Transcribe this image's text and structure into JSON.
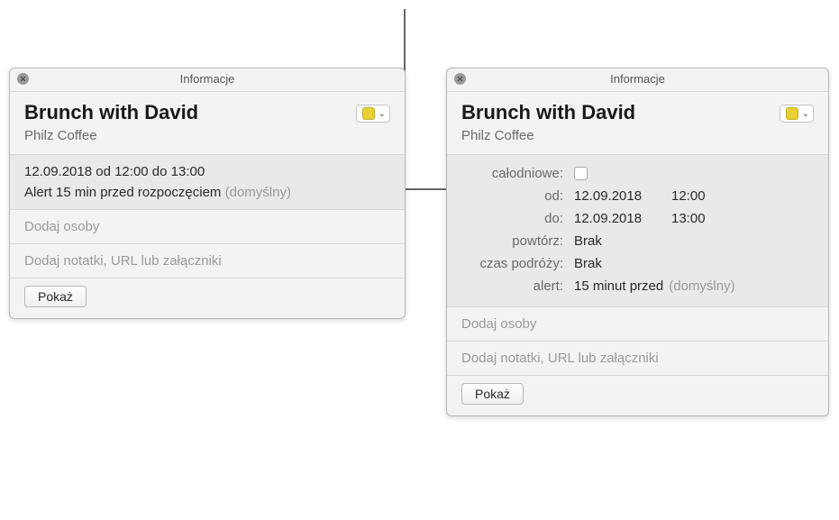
{
  "window_title": "Informacje",
  "event": {
    "title": "Brunch with David",
    "location": "Philz Coffee"
  },
  "left": {
    "time_line": "12.09.2018  od 12:00 do 13:00",
    "alert_prefix": "Alert 15 min przed rozpoczęciem",
    "alert_default": "(domyślny)"
  },
  "right": {
    "labels": {
      "allday": "całodniowe:",
      "from": "od:",
      "to": "do:",
      "repeat": "powtórz:",
      "travel": "czas podróży:",
      "alert": "alert:"
    },
    "from_date": "12.09.2018",
    "from_time": "12:00",
    "to_date": "12.09.2018",
    "to_time": "13:00",
    "repeat_value": "Brak",
    "travel_value": "Brak",
    "alert_value": "15 minut przed",
    "alert_default": "(domyślny)"
  },
  "placeholders": {
    "invitees": "Dodaj osoby",
    "notes": "Dodaj notatki, URL lub załączniki"
  },
  "buttons": {
    "show": "Pokaż"
  },
  "colors": {
    "calendar": "#e8d034"
  }
}
